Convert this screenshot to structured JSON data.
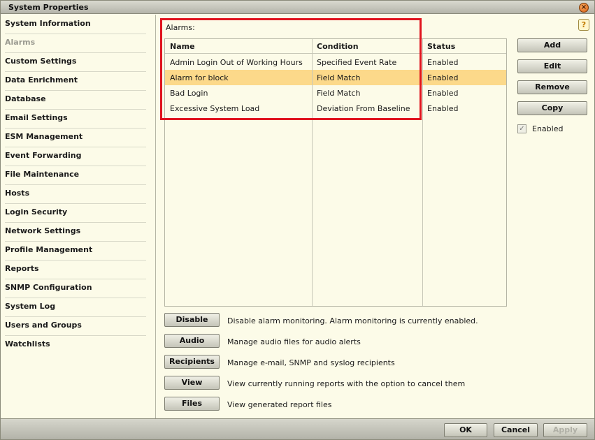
{
  "window": {
    "title": "System Properties"
  },
  "sidebar": {
    "items": [
      {
        "label": "System Information"
      },
      {
        "label": "Alarms"
      },
      {
        "label": "Custom Settings"
      },
      {
        "label": "Data Enrichment"
      },
      {
        "label": "Database"
      },
      {
        "label": "Email Settings"
      },
      {
        "label": "ESM Management"
      },
      {
        "label": "Event Forwarding"
      },
      {
        "label": "File Maintenance"
      },
      {
        "label": "Hosts"
      },
      {
        "label": "Login Security"
      },
      {
        "label": "Network Settings"
      },
      {
        "label": "Profile Management"
      },
      {
        "label": "Reports"
      },
      {
        "label": "SNMP Configuration"
      },
      {
        "label": "System Log"
      },
      {
        "label": "Users and Groups"
      },
      {
        "label": "Watchlists"
      }
    ]
  },
  "alarms": {
    "label": "Alarms:",
    "columns": [
      "Name",
      "Condition",
      "Status"
    ],
    "rows": [
      {
        "name": "Admin Login Out of Working Hours",
        "condition": "Specified Event Rate",
        "status": "Enabled"
      },
      {
        "name": "Alarm for block",
        "condition": "Field Match",
        "status": "Enabled"
      },
      {
        "name": "Bad Login",
        "condition": "Field Match",
        "status": "Enabled"
      },
      {
        "name": "Excessive System Load",
        "condition": "Deviation From Baseline",
        "status": "Enabled"
      }
    ]
  },
  "side_buttons": {
    "add": "Add",
    "edit": "Edit",
    "remove": "Remove",
    "copy": "Copy"
  },
  "enabled_checkbox": {
    "label": "Enabled",
    "checked": true
  },
  "actions": [
    {
      "button": "Disable",
      "description": "Disable alarm monitoring.  Alarm monitoring is currently enabled."
    },
    {
      "button": "Audio",
      "description": "Manage audio files for audio alerts"
    },
    {
      "button": "Recipients",
      "description": "Manage e-mail, SNMP and syslog recipients"
    },
    {
      "button": "View",
      "description": "View currently running reports with the option to cancel them"
    },
    {
      "button": "Files",
      "description": "View generated report files"
    }
  ],
  "footer": {
    "ok": "OK",
    "cancel": "Cancel",
    "apply": "Apply"
  },
  "colors": {
    "background": "#fcfbe8",
    "selected_row": "#fcd98a",
    "highlight": "#e0141e"
  },
  "icons": {
    "close": "close-icon",
    "help": "help-icon",
    "checkbox": "checkmark-icon"
  }
}
